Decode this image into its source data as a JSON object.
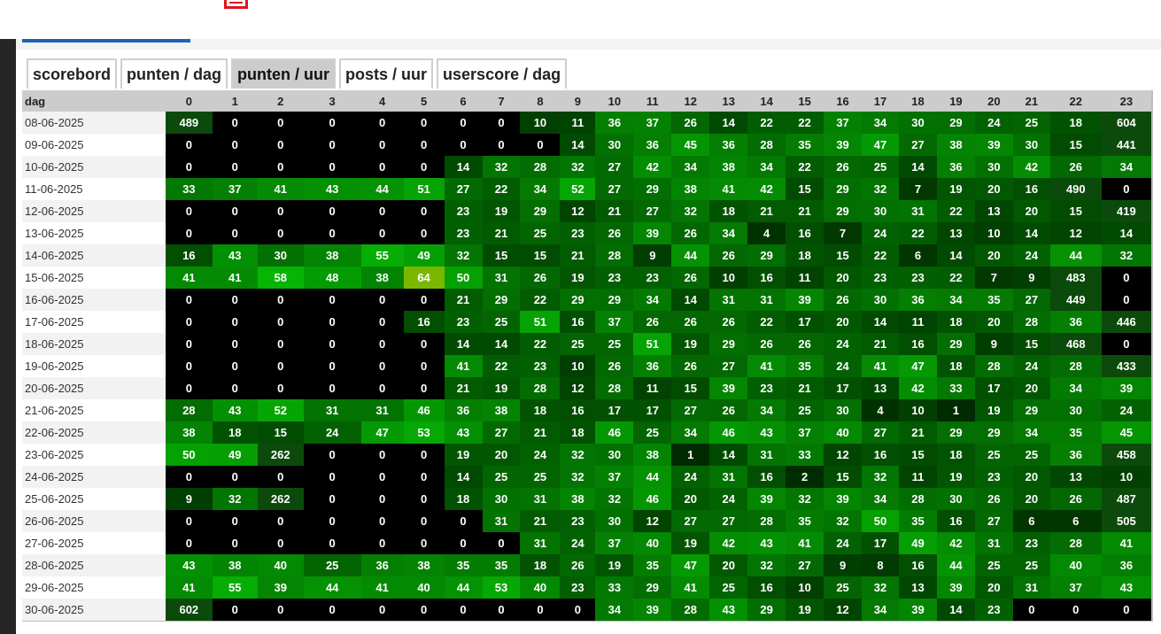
{
  "tabs": [
    {
      "label": "scorebord",
      "active": false
    },
    {
      "label": "punten / dag",
      "active": false
    },
    {
      "label": "punten / uur",
      "active": true
    },
    {
      "label": "posts / uur",
      "active": false
    },
    {
      "label": "userscore / dag",
      "active": false
    }
  ],
  "grid": {
    "day_header": "dag",
    "hours": [
      "0",
      "1",
      "2",
      "3",
      "4",
      "5",
      "6",
      "7",
      "8",
      "9",
      "10",
      "11",
      "12",
      "13",
      "14",
      "15",
      "16",
      "17",
      "18",
      "19",
      "20",
      "21",
      "22",
      "23"
    ],
    "rows": [
      {
        "date": "08-06-2025",
        "values": [
          489,
          0,
          0,
          0,
          0,
          0,
          0,
          0,
          10,
          11,
          36,
          37,
          26,
          14,
          22,
          22,
          37,
          34,
          30,
          29,
          24,
          25,
          18,
          604
        ]
      },
      {
        "date": "09-06-2025",
        "values": [
          0,
          0,
          0,
          0,
          0,
          0,
          0,
          0,
          0,
          14,
          30,
          36,
          45,
          36,
          28,
          35,
          39,
          47,
          27,
          38,
          39,
          30,
          15,
          441
        ]
      },
      {
        "date": "10-06-2025",
        "values": [
          0,
          0,
          0,
          0,
          0,
          0,
          14,
          32,
          28,
          32,
          27,
          42,
          34,
          38,
          34,
          22,
          26,
          25,
          14,
          36,
          30,
          42,
          26,
          34
        ]
      },
      {
        "date": "11-06-2025",
        "values": [
          33,
          37,
          41,
          43,
          44,
          51,
          27,
          22,
          34,
          52,
          27,
          29,
          38,
          41,
          42,
          15,
          29,
          32,
          7,
          19,
          20,
          16,
          490,
          0
        ]
      },
      {
        "date": "12-06-2025",
        "values": [
          0,
          0,
          0,
          0,
          0,
          0,
          23,
          19,
          29,
          12,
          21,
          27,
          32,
          18,
          21,
          21,
          29,
          30,
          31,
          22,
          13,
          20,
          15,
          419
        ]
      },
      {
        "date": "13-06-2025",
        "values": [
          0,
          0,
          0,
          0,
          0,
          0,
          23,
          21,
          25,
          23,
          26,
          39,
          26,
          34,
          4,
          16,
          7,
          24,
          22,
          13,
          10,
          14,
          12,
          14
        ]
      },
      {
        "date": "14-06-2025",
        "values": [
          16,
          43,
          30,
          38,
          55,
          49,
          32,
          15,
          15,
          21,
          28,
          9,
          44,
          26,
          29,
          18,
          15,
          22,
          6,
          14,
          20,
          24,
          44,
          32
        ]
      },
      {
        "date": "15-06-2025",
        "values": [
          41,
          41,
          58,
          48,
          38,
          64,
          50,
          31,
          26,
          19,
          23,
          23,
          26,
          10,
          16,
          11,
          20,
          23,
          23,
          22,
          7,
          9,
          483,
          0
        ]
      },
      {
        "date": "16-06-2025",
        "values": [
          0,
          0,
          0,
          0,
          0,
          0,
          21,
          29,
          22,
          29,
          29,
          34,
          14,
          31,
          31,
          39,
          26,
          30,
          36,
          34,
          35,
          27,
          449,
          0
        ]
      },
      {
        "date": "17-06-2025",
        "values": [
          0,
          0,
          0,
          0,
          0,
          16,
          23,
          25,
          51,
          16,
          37,
          26,
          26,
          26,
          22,
          17,
          20,
          14,
          11,
          18,
          20,
          28,
          36,
          446
        ]
      },
      {
        "date": "18-06-2025",
        "values": [
          0,
          0,
          0,
          0,
          0,
          0,
          14,
          14,
          22,
          25,
          25,
          51,
          19,
          29,
          26,
          26,
          24,
          21,
          16,
          29,
          9,
          15,
          468,
          0
        ]
      },
      {
        "date": "19-06-2025",
        "values": [
          0,
          0,
          0,
          0,
          0,
          0,
          41,
          22,
          23,
          10,
          26,
          36,
          26,
          27,
          41,
          35,
          24,
          41,
          47,
          18,
          28,
          24,
          28,
          433
        ]
      },
      {
        "date": "20-06-2025",
        "values": [
          0,
          0,
          0,
          0,
          0,
          0,
          21,
          19,
          28,
          12,
          28,
          11,
          15,
          39,
          23,
          21,
          17,
          13,
          42,
          33,
          17,
          20,
          34,
          39
        ]
      },
      {
        "date": "21-06-2025",
        "values": [
          28,
          43,
          52,
          31,
          31,
          46,
          36,
          38,
          18,
          16,
          17,
          17,
          27,
          26,
          34,
          25,
          30,
          4,
          10,
          1,
          19,
          29,
          30,
          24
        ]
      },
      {
        "date": "22-06-2025",
        "values": [
          38,
          18,
          15,
          24,
          47,
          53,
          43,
          27,
          21,
          18,
          46,
          25,
          34,
          46,
          43,
          37,
          40,
          27,
          21,
          29,
          29,
          34,
          35,
          45
        ]
      },
      {
        "date": "23-06-2025",
        "values": [
          50,
          49,
          262,
          0,
          0,
          0,
          19,
          20,
          24,
          32,
          30,
          38,
          1,
          14,
          31,
          33,
          12,
          16,
          15,
          18,
          25,
          25,
          36,
          458
        ]
      },
      {
        "date": "24-06-2025",
        "values": [
          0,
          0,
          0,
          0,
          0,
          0,
          14,
          25,
          25,
          32,
          37,
          44,
          24,
          31,
          16,
          2,
          15,
          32,
          11,
          19,
          23,
          20,
          13,
          10
        ]
      },
      {
        "date": "25-06-2025",
        "values": [
          9,
          32,
          262,
          0,
          0,
          0,
          18,
          30,
          31,
          38,
          32,
          46,
          20,
          24,
          39,
          32,
          39,
          34,
          28,
          30,
          26,
          20,
          26,
          487
        ]
      },
      {
        "date": "26-06-2025",
        "values": [
          0,
          0,
          0,
          0,
          0,
          0,
          0,
          31,
          21,
          23,
          30,
          12,
          27,
          27,
          28,
          35,
          32,
          50,
          35,
          16,
          27,
          6,
          6,
          505
        ]
      },
      {
        "date": "27-06-2025",
        "values": [
          0,
          0,
          0,
          0,
          0,
          0,
          0,
          0,
          31,
          24,
          37,
          40,
          19,
          42,
          43,
          41,
          24,
          17,
          49,
          42,
          31,
          23,
          28,
          41
        ]
      },
      {
        "date": "28-06-2025",
        "values": [
          43,
          38,
          40,
          25,
          36,
          38,
          35,
          35,
          18,
          26,
          19,
          35,
          47,
          20,
          32,
          27,
          9,
          8,
          16,
          44,
          25,
          25,
          40,
          36
        ]
      },
      {
        "date": "29-06-2025",
        "values": [
          41,
          55,
          39,
          44,
          41,
          40,
          44,
          53,
          40,
          23,
          33,
          29,
          41,
          25,
          16,
          10,
          25,
          32,
          13,
          39,
          20,
          31,
          37,
          43
        ]
      },
      {
        "date": "30-06-2025",
        "values": [
          602,
          0,
          0,
          0,
          0,
          0,
          0,
          0,
          0,
          0,
          34,
          39,
          28,
          43,
          29,
          19,
          12,
          34,
          39,
          14,
          23,
          0,
          0,
          0
        ]
      }
    ]
  },
  "colors": {
    "zero": "#000000",
    "low": "#0a3d0a",
    "high": "#00b400",
    "peak": "#7ab800",
    "accent_blue": "#1f63b3",
    "icon_red": "#e0141e"
  },
  "icons": [
    "menu-icon"
  ]
}
